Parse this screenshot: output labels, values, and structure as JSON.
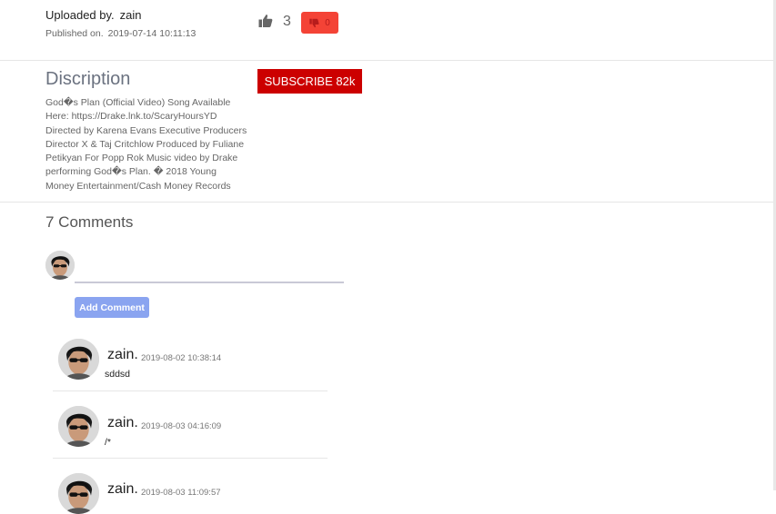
{
  "video_meta": {
    "uploaded_by_label": "Uploaded by.",
    "uploader_name": "zain",
    "published_label": "Published on.",
    "published_date": "2019-07-14 10:11:13",
    "like_count": "3",
    "dislike_count": "0",
    "like_icon": "thumbs-up-icon",
    "dislike_icon": "thumbs-down-icon"
  },
  "description": {
    "title": "Discription",
    "text": "God�s Plan (Official Video) Song Available Here: https://Drake.lnk.to/ScaryHoursYD Directed by Karena Evans Executive Producers Director X & Taj Critchlow Produced by Fuliane Petikyan For Popp Rok Music video by Drake performing God�s Plan. � 2018 Young Money Entertainment/Cash Money Records",
    "subscribe_label": "SUBSCRIBE 82k"
  },
  "comments_section": {
    "title": "7 Comments",
    "input_placeholder": "",
    "add_button_label": "Add Comment",
    "items": [
      {
        "name": "zain.",
        "date": "2019-08-02 10:38:14",
        "text": "sddsd"
      },
      {
        "name": "zain.",
        "date": "2019-08-03 04:16:09",
        "text": "/*"
      },
      {
        "name": "zain.",
        "date": "2019-08-03 11:09:57",
        "text": ""
      }
    ]
  },
  "colors": {
    "subscribe_bg": "#cc0000",
    "dislike_bg": "#f44336",
    "add_comment_bg": "#8aa4f0"
  }
}
